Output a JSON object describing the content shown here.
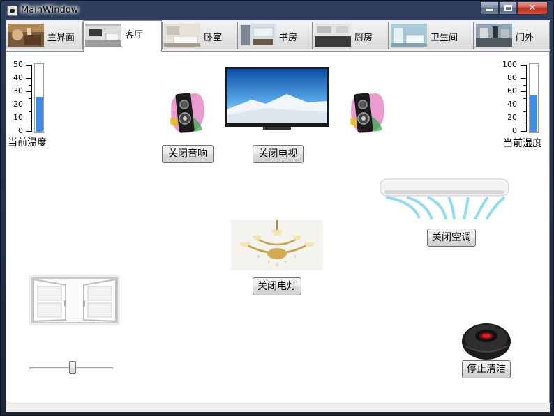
{
  "window": {
    "title": "MainWindow"
  },
  "tabs": [
    {
      "label": "主界面"
    },
    {
      "label": "客厅"
    },
    {
      "label": "卧室"
    },
    {
      "label": "书房"
    },
    {
      "label": "厨房"
    },
    {
      "label": "卫生间"
    },
    {
      "label": "门外"
    }
  ],
  "active_tab": "客厅",
  "temperature": {
    "caption": "当前温度",
    "ticks": [
      "50",
      "40",
      "30",
      "20",
      "10",
      "0"
    ],
    "max": 50,
    "value": 26
  },
  "humidity": {
    "caption": "当前湿度",
    "ticks": [
      "100",
      "80",
      "60",
      "40",
      "20",
      "0"
    ],
    "max": 100,
    "value": 55
  },
  "buttons": {
    "speaker": "关闭音响",
    "tv": "关闭电视",
    "ac": "关闭空调",
    "light": "关闭电灯",
    "cleaner": "停止清洁"
  },
  "curtain": {
    "slider_value": 52
  },
  "colors": {
    "accent": "#3d8ee6"
  }
}
